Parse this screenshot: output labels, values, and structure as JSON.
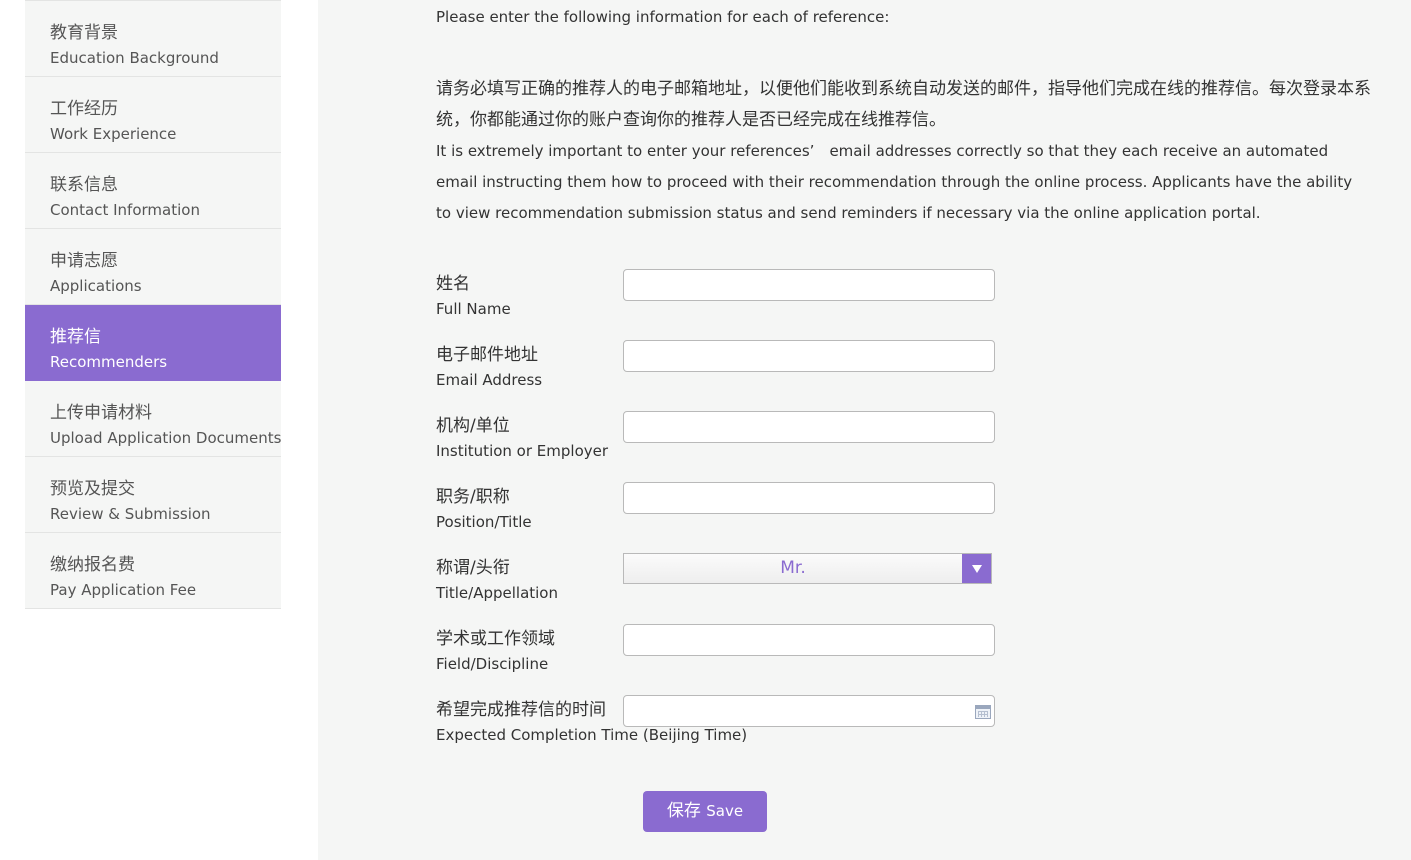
{
  "sidebar": {
    "items": [
      {
        "zh": "教育背景",
        "en": "Education Background",
        "active": false
      },
      {
        "zh": "工作经历",
        "en": "Work Experience",
        "active": false
      },
      {
        "zh": "联系信息",
        "en": "Contact Information",
        "active": false
      },
      {
        "zh": "申请志愿",
        "en": "Applications",
        "active": false
      },
      {
        "zh": "推荐信",
        "en": "Recommenders",
        "active": true
      },
      {
        "zh": "上传申请材料",
        "en": "Upload Application Documents",
        "active": false
      },
      {
        "zh": "预览及提交",
        "en": "Review & Submission",
        "active": false
      },
      {
        "zh": "缴纳报名费",
        "en": "Pay Application Fee",
        "active": false
      }
    ]
  },
  "main": {
    "intro_en": "Please enter the following information for each of reference:",
    "intro_zh": "请务必填写正确的推荐人的电子邮箱地址，以便他们能收到系统自动发送的邮件，指导他们完成在线的推荐信。每次登录本系统，你都能通过你的账户查询你的推荐人是否已经完成在线推荐信。",
    "intro_en2": "It is extremely important to enter your references’　email addresses correctly so that they each receive an automated email instructing them how to proceed with their recommendation through the online process. Applicants have the ability to view recommendation submission status and send reminders if necessary via the online application portal."
  },
  "form": {
    "fields": [
      {
        "zh": "姓名",
        "en": "Full Name",
        "value": "",
        "type": "text"
      },
      {
        "zh": "电子邮件地址",
        "en": "Email Address",
        "value": "",
        "type": "text"
      },
      {
        "zh": "机构/单位",
        "en": "Institution or Employer",
        "value": "",
        "type": "text"
      },
      {
        "zh": "职务/职称",
        "en": "Position/Title",
        "value": "",
        "type": "text"
      },
      {
        "zh": "称谓/头衔",
        "en": "Title/Appellation",
        "value": "Mr.",
        "type": "select"
      },
      {
        "zh": "学术或工作领域",
        "en": "Field/Discipline",
        "value": "",
        "type": "text"
      },
      {
        "zh": "希望完成推荐信的时间",
        "en": "Expected Completion Time (Beijing Time)",
        "value": "",
        "type": "date"
      }
    ],
    "save_zh": "保存",
    "save_en": "Save"
  },
  "colors": {
    "accent": "#8a6bd0",
    "panel_bg": "#f5f6f5",
    "text": "#333333"
  },
  "icons": {
    "select_arrow": "chevron-down-icon",
    "date_picker": "calendar-icon"
  }
}
